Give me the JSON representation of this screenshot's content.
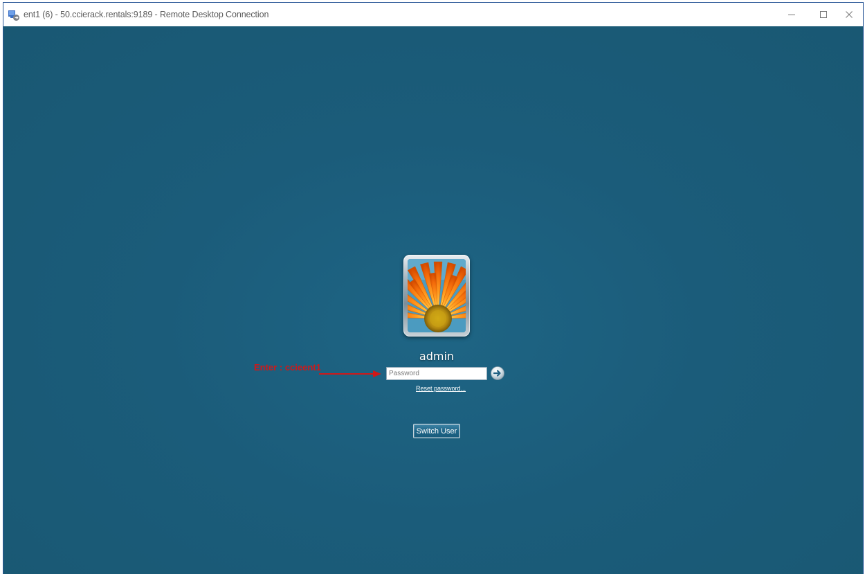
{
  "window": {
    "title": "ent1 (6) - 50.ccierack.rentals:9189 - Remote Desktop Connection",
    "app_icon": "remote-desktop-icon",
    "controls": {
      "minimize_icon": "minimize-icon",
      "maximize_icon": "maximize-icon",
      "close_icon": "close-icon"
    }
  },
  "login": {
    "username": "admin",
    "password_placeholder": "Password",
    "password_value": "",
    "submit_icon": "arrow-right-circle-icon",
    "reset_link": "Reset password...",
    "switch_user_label": "Switch User"
  },
  "annotation": {
    "text": "Enter : ccieent1",
    "color": "#d01818"
  },
  "colors": {
    "desktop_background": "#1b5c7a",
    "titlebar_background": "#ffffff",
    "window_border": "#2b5797"
  }
}
